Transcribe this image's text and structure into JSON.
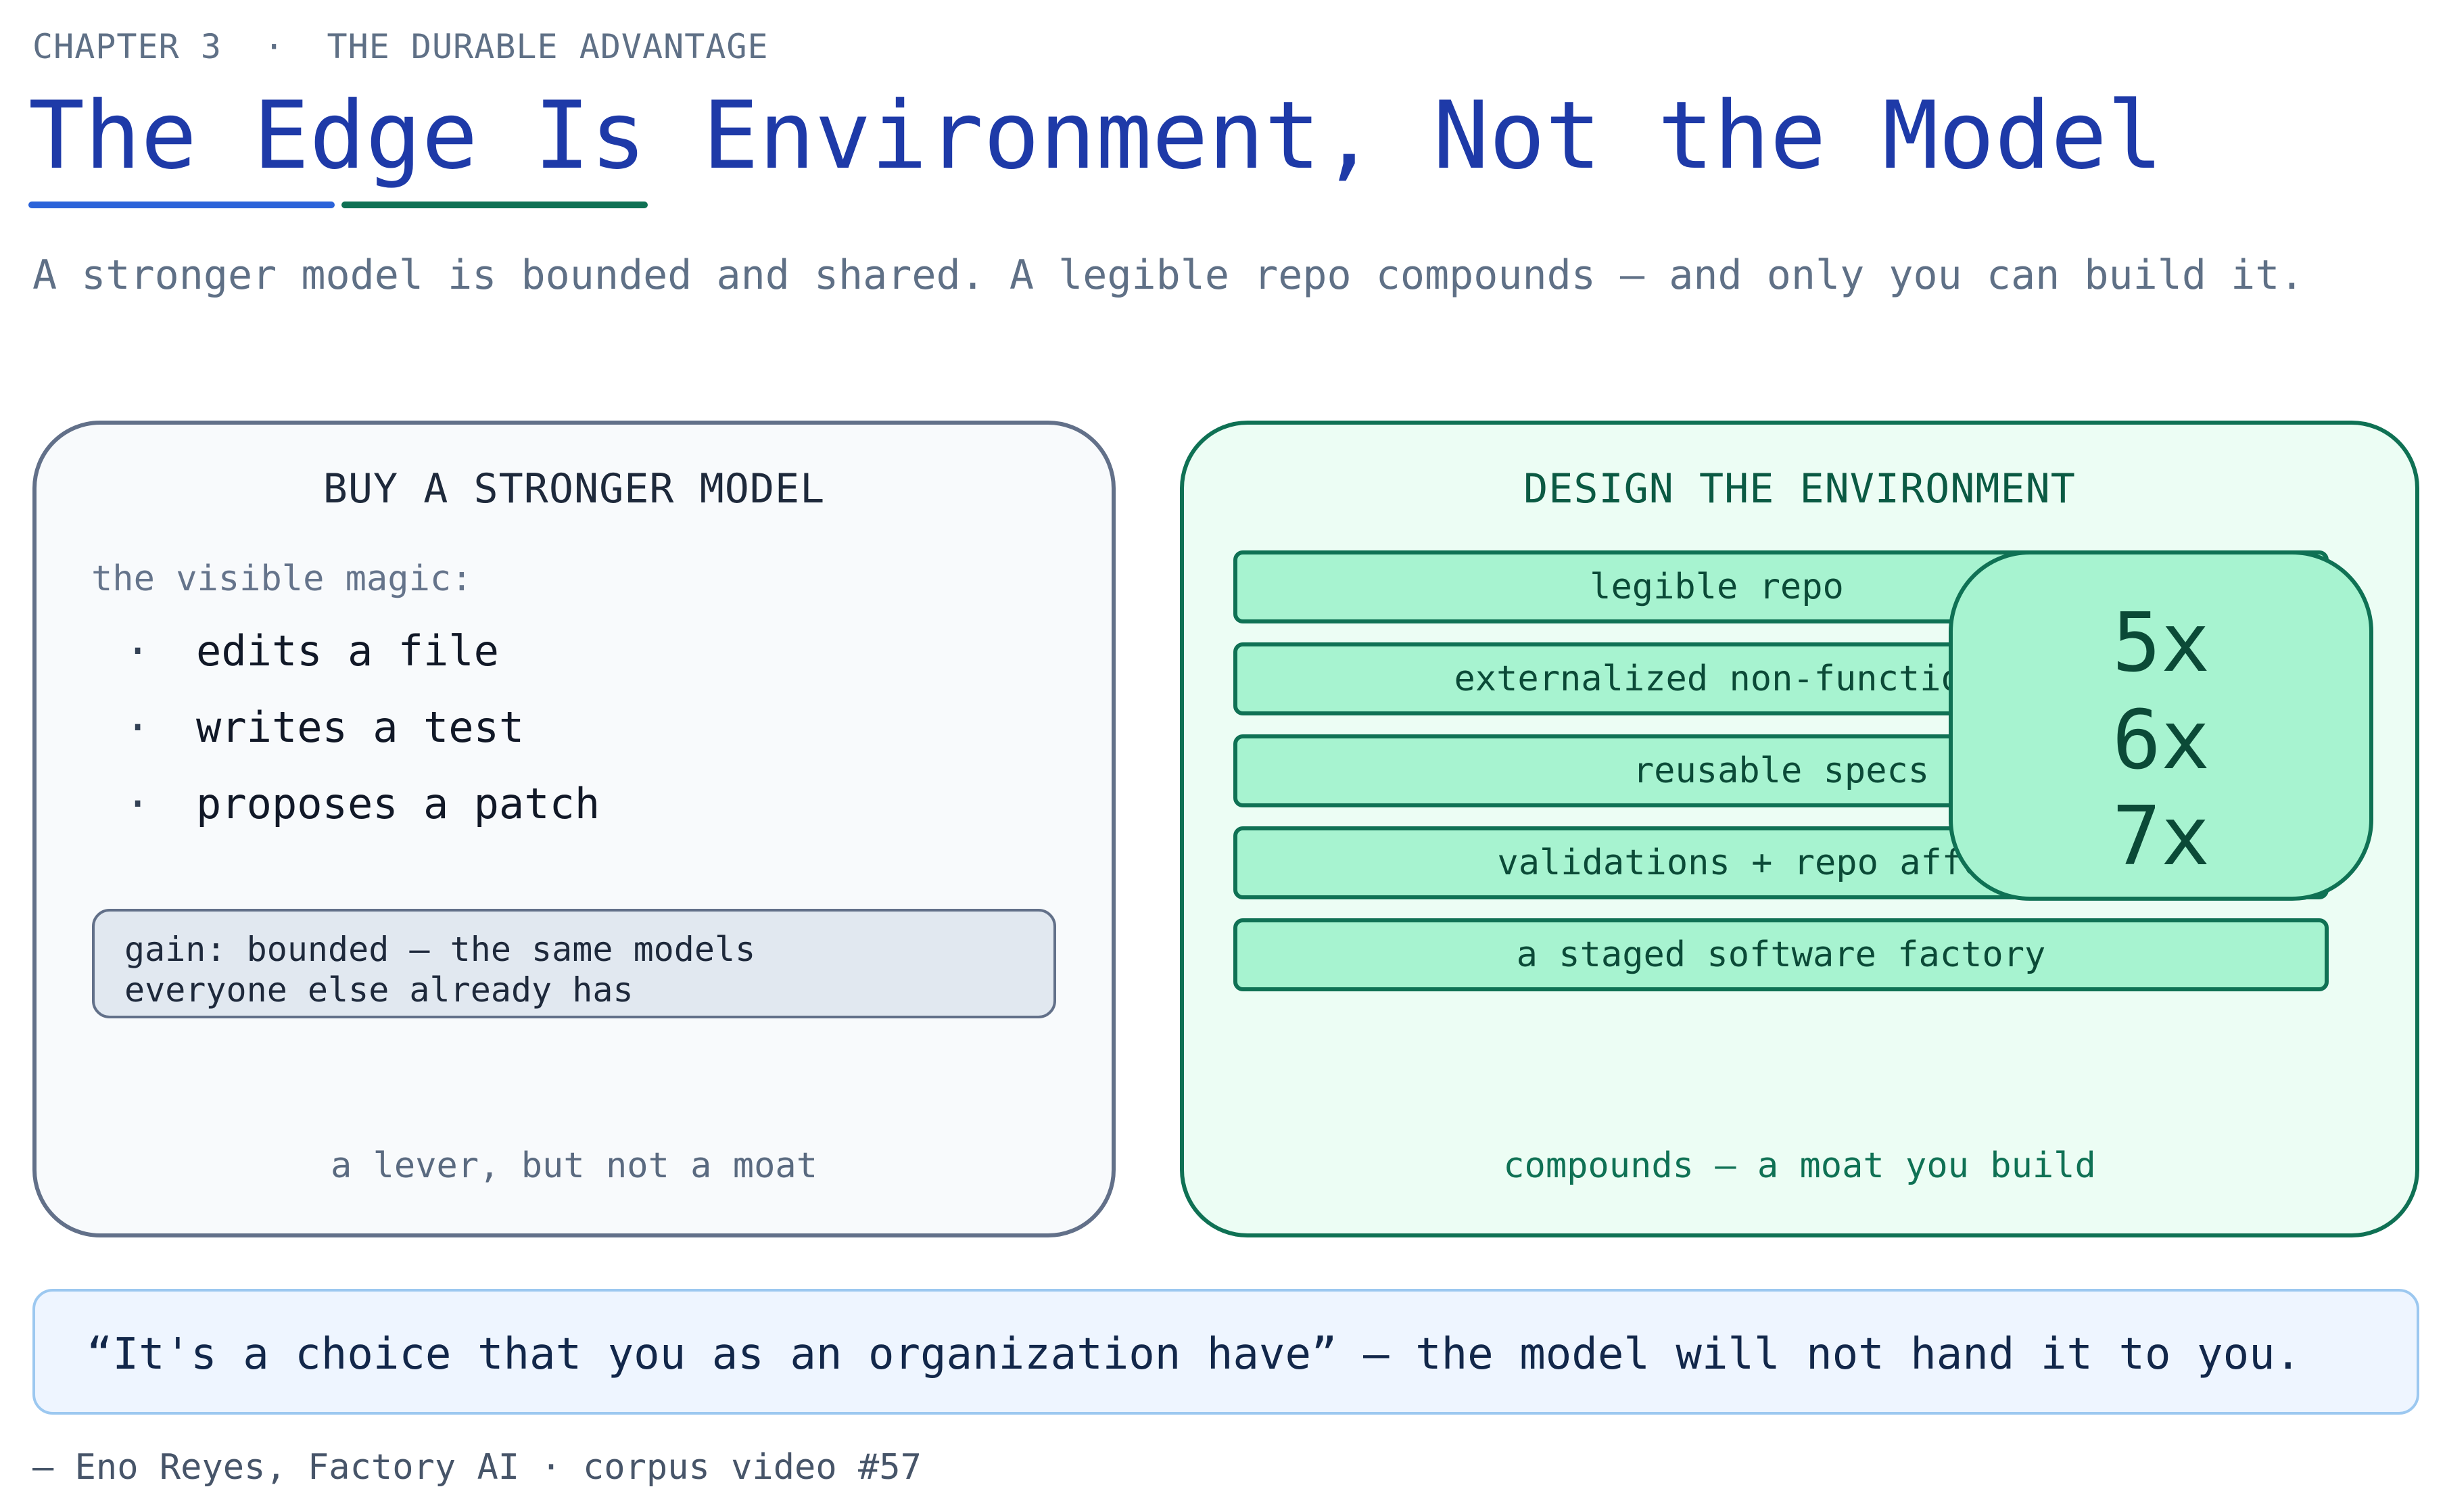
{
  "header": {
    "chapter": "CHAPTER 3",
    "separator": "·",
    "section": "THE DURABLE ADVANTAGE",
    "title": "The Edge Is Environment, Not the Model",
    "subtitle": "A stronger model is bounded and shared. A legible repo compounds — and only you can build it.",
    "underline_colors": [
      "#2b63d9",
      "#0f7154"
    ]
  },
  "left_panel": {
    "title": "BUY A STRONGER MODEL",
    "intro": "the visible magic:",
    "bullet_glyph": "·",
    "bullets": [
      "edits a file",
      "writes a test",
      "proposes a patch"
    ],
    "gain_lines": [
      "gain: bounded — the same models",
      "everyone else already has"
    ],
    "caption": "a lever, but not a moat"
  },
  "right_panel": {
    "title": "DESIGN THE ENVIRONMENT",
    "layers": [
      "legible repo",
      "externalized non-functional judgment",
      "reusable specs",
      "validations + repo affordances",
      "a staged software factory"
    ],
    "multipliers": [
      "5x",
      "6x",
      "7x"
    ],
    "caption": "compounds — a moat you build"
  },
  "quote": {
    "text": "“It's a choice that you as an organization have” — the model will not hand it to you."
  },
  "attribution": "— Eno Reyes, Factory AI · corpus video #57",
  "colors": {
    "title_blue": "#1e3aa8",
    "slate_border": "#627089",
    "green_border": "#0f7154",
    "green_fill": "#a7f3d0",
    "quote_fill": "#eef5ff"
  }
}
